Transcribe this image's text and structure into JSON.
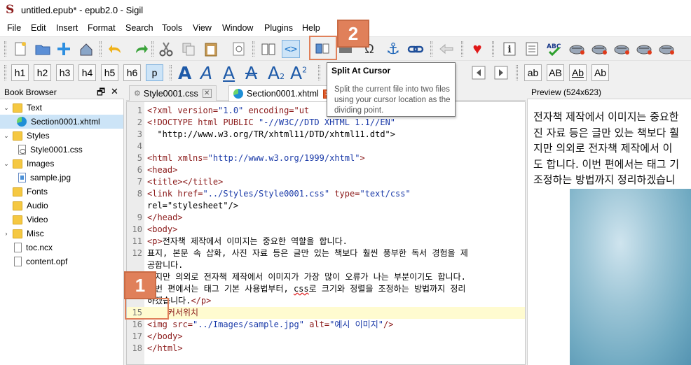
{
  "window": {
    "title": "untitled.epub* - epub2.0 - Sigil"
  },
  "menu": [
    "File",
    "Edit",
    "Insert",
    "Format",
    "Search",
    "Tools",
    "View",
    "Window",
    "Plugins",
    "Help"
  ],
  "heading_buttons": [
    "h1",
    "h2",
    "h3",
    "h4",
    "h5",
    "h6",
    "p"
  ],
  "case_buttons": [
    "ab",
    "AB",
    "Ab",
    "Ab"
  ],
  "tooltip": {
    "title": "Split At Cursor",
    "body": "Split the current file into two files using your cursor location as the dividing point."
  },
  "book_browser": {
    "title": "Book Browser",
    "items": [
      {
        "label": "Text",
        "type": "folder"
      },
      {
        "label": "Section0001.xhtml",
        "type": "xhtml"
      },
      {
        "label": "Styles",
        "type": "folder"
      },
      {
        "label": "Style0001.css",
        "type": "css"
      },
      {
        "label": "Images",
        "type": "folder"
      },
      {
        "label": "sample.jpg",
        "type": "image"
      },
      {
        "label": "Fonts",
        "type": "folder"
      },
      {
        "label": "Audio",
        "type": "folder"
      },
      {
        "label": "Video",
        "type": "folder"
      },
      {
        "label": "Misc",
        "type": "folder"
      },
      {
        "label": "toc.ncx",
        "type": "file"
      },
      {
        "label": "content.opf",
        "type": "file"
      }
    ]
  },
  "tabs": [
    {
      "label": "Style0001.css"
    },
    {
      "label": "Section0001.xhtml"
    }
  ],
  "code_lines": [
    {
      "n": "1",
      "text": "<?xml version=\"1.0\" encoding=\"ut"
    },
    {
      "n": "2",
      "text": "<!DOCTYPE html PUBLIC \"-//W3C//DTD XHTML 1.1//EN\""
    },
    {
      "n": "3",
      "text": "  \"http://www.w3.org/TR/xhtml11/DTD/xhtml11.dtd\">"
    },
    {
      "n": "4",
      "text": ""
    },
    {
      "n": "5",
      "text": "<html xmlns=\"http://www.w3.org/1999/xhtml\">"
    },
    {
      "n": "6",
      "text": "<head>"
    },
    {
      "n": "7",
      "text": "<title></title>"
    },
    {
      "n": "8",
      "text": "<link href=\"../Styles/Style0001.css\" type=\"text/css\""
    },
    {
      "n": "",
      "text": "rel=\"stylesheet\"/>"
    },
    {
      "n": "9",
      "text": "</head>"
    },
    {
      "n": "10",
      "text": "<body>"
    },
    {
      "n": "11",
      "text": "<p>전자책 제작에서 이미지는 중요한 역할을 합니다."
    },
    {
      "n": "12",
      "text": "표지, 본문 속 삽화, 사진 자료 등은 글만 있는 책보다 훨씬 풍부한 독서 경험을 제"
    },
    {
      "n": "",
      "text": "공합니다."
    },
    {
      "n": "13",
      "text": "하지만 의외로 전자책 제작에서 이미지가 가장 많이 오류가 나는 부분이기도 합니다."
    },
    {
      "n": "14",
      "text": "이번 편에서는 태그 기본 사용법부터, css로 크기와 정렬을 조정하는 방법까지 정리"
    },
    {
      "n": "",
      "text": "하겠습니다.</p>"
    },
    {
      "n": "15",
      "text": "    커서위치"
    },
    {
      "n": "16",
      "text": "<img src=\"../Images/sample.jpg\" alt=\"예시 이미지\"/>"
    },
    {
      "n": "17",
      "text": "</body>"
    },
    {
      "n": "18",
      "text": "</html>"
    }
  ],
  "preview": {
    "title": "Preview (524x623)",
    "text_lines": [
      "전자책 제작에서 이미지는 중요한",
      "진 자료 등은 글만 있는 책보다 훨",
      "지만 의외로 전자책 제작에서 이",
      "도 합니다. 이번 편에서는 태그 기",
      "조정하는 방법까지 정리하겠습니"
    ]
  },
  "annotations": [
    "1",
    "2"
  ],
  "colors": {
    "annotation": "#e0805a",
    "tag": "#8b1a1a",
    "attr": "#1a3aa8",
    "highlight": "#fffbd0"
  }
}
